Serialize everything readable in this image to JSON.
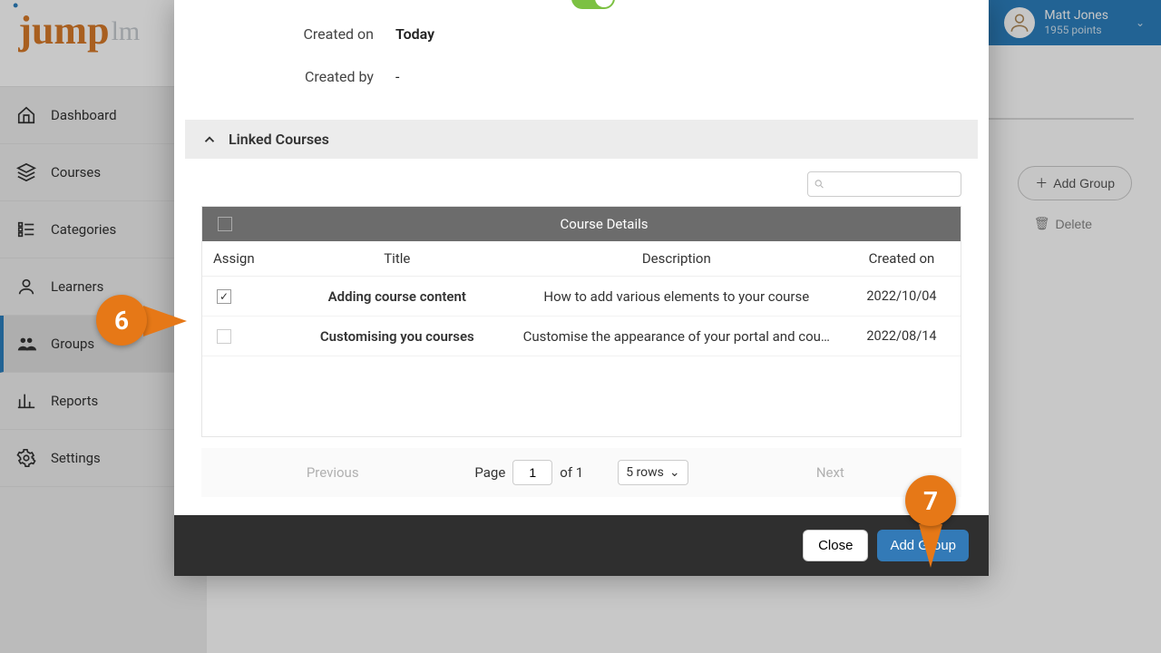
{
  "user": {
    "name": "Matt Jones",
    "points": "1955 points"
  },
  "logo": {
    "main": "jump",
    "suffix": "lm"
  },
  "sidebar": {
    "items": [
      {
        "label": "Dashboard"
      },
      {
        "label": "Courses"
      },
      {
        "label": "Categories"
      },
      {
        "label": "Learners"
      },
      {
        "label": "Groups"
      },
      {
        "label": "Reports"
      },
      {
        "label": "Settings"
      }
    ]
  },
  "bg_buttons": {
    "add": "Add Group",
    "delete": "Delete"
  },
  "modal": {
    "created_on_label": "Created on",
    "created_on_value": "Today",
    "created_by_label": "Created by",
    "created_by_value": "-",
    "section_title": "Linked Courses",
    "table_header": "Course Details",
    "columns": {
      "assign": "Assign",
      "title": "Title",
      "desc": "Description",
      "date": "Created on"
    },
    "rows": [
      {
        "checked": true,
        "title": "Adding course content",
        "desc": "How to add various elements to your course",
        "date": "2022/10/04"
      },
      {
        "checked": false,
        "title": "Customising you courses",
        "desc": "Customise the appearance of your portal and cou…",
        "date": "2022/08/14"
      }
    ],
    "pager": {
      "prev": "Previous",
      "next": "Next",
      "page_label": "Page",
      "page": "1",
      "of": "of 1",
      "rows": "5 rows"
    },
    "footer": {
      "close": "Close",
      "add": "Add Group"
    }
  },
  "callouts": {
    "c6": "6",
    "c7": "7"
  }
}
